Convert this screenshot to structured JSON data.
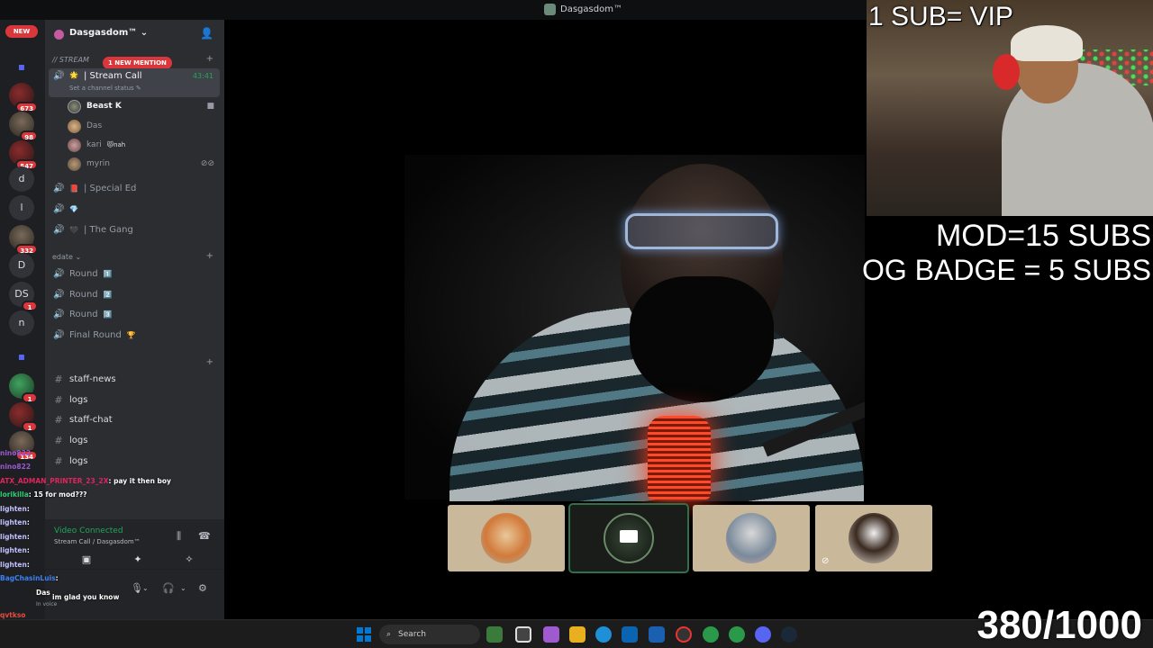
{
  "window": {
    "title": "Dasgasdom™"
  },
  "rail": {
    "new_label": "NEW",
    "servers": [
      {
        "label": "▪",
        "badge": ""
      },
      {
        "label": "",
        "badge": "673"
      },
      {
        "label": "",
        "badge": "98"
      },
      {
        "label": "",
        "badge": "547"
      },
      {
        "label": "d",
        "badge": ""
      },
      {
        "label": "l",
        "badge": ""
      },
      {
        "label": "",
        "badge": "332"
      },
      {
        "label": "D",
        "badge": ""
      },
      {
        "label": "DS",
        "badge": "1"
      },
      {
        "label": "n",
        "badge": ""
      },
      {
        "label": "▪",
        "badge": ""
      },
      {
        "label": "",
        "badge": "1"
      },
      {
        "label": "",
        "badge": "1"
      },
      {
        "label": "",
        "badge": "134"
      }
    ]
  },
  "sidebar": {
    "server_name": "Dasgasdom™",
    "mention_pill": "1 NEW MENTION",
    "category_stream": "// STREAM",
    "category_edate": "edate",
    "active_channel": {
      "name": "Stream Call",
      "time": "43:41",
      "status": "Set a channel status"
    },
    "users": [
      {
        "name": "Beast K"
      },
      {
        "name": "Das"
      },
      {
        "name": "kari",
        "tag": "😾nah"
      },
      {
        "name": "myrin"
      }
    ],
    "voice_channels": [
      {
        "name": "Special Ed"
      },
      {
        "name": ""
      },
      {
        "name": "The Gang"
      }
    ],
    "round_channels": [
      {
        "name": "Round",
        "emoji": "1️⃣"
      },
      {
        "name": "Round",
        "emoji": "2️⃣"
      },
      {
        "name": "Round",
        "emoji": "3️⃣"
      },
      {
        "name": "Final Round",
        "emoji": "🏆"
      }
    ],
    "text_channels": [
      {
        "name": "staff-news"
      },
      {
        "name": "logs"
      },
      {
        "name": "staff-chat"
      },
      {
        "name": "logs"
      },
      {
        "name": "logs"
      }
    ],
    "voice_connected": "Video Connected",
    "voice_location": "Stream Call / Dasgasdom™",
    "user_name": "Das",
    "user_status": "In voice"
  },
  "chat": [
    {
      "nick": "nino822",
      "msg": "",
      "color": "#9b59d0"
    },
    {
      "nick": "nino822",
      "msg": "",
      "color": "#9b59d0"
    },
    {
      "nick": "ATX_ADMAN_PRINTER_23_2X",
      "msg": ": pay it then boy",
      "color": "#e0245e"
    },
    {
      "nick": "lorikilla",
      "msg": ": 15 for mod???",
      "color": "#2ecc71"
    },
    {
      "nick": "lighten",
      "msg": ":",
      "color": "#c0c0ff"
    },
    {
      "nick": "lighten",
      "msg": ":",
      "color": "#c0c0ff"
    },
    {
      "nick": "lighten",
      "msg": ":",
      "color": "#c0c0ff"
    },
    {
      "nick": "lighten",
      "msg": ":",
      "color": "#c0c0ff"
    },
    {
      "nick": "lighten",
      "msg": ":",
      "color": "#c0c0ff"
    },
    {
      "nick": "BagChasinLuis",
      "msg": ":",
      "color": "#3b82f6"
    },
    {
      "nick": "",
      "msg": "im glad you know",
      "color": "#ffffff"
    },
    {
      "nick": "",
      "msg": "",
      "color": "#ffffff"
    },
    {
      "nick": "qvtkso",
      "msg": "",
      "color": "#e74c3c"
    },
    {
      "nick": "qvtkso",
      "msg": "",
      "color": "#e74c3c"
    }
  ],
  "overlay": {
    "sub_vip": "1 SUB= VIP",
    "mod": "MOD=15 SUBS",
    "og": "OG BADGE = 5 SUBS",
    "goal": "380/1000"
  },
  "taskbar": {
    "search_placeholder": "Search"
  }
}
